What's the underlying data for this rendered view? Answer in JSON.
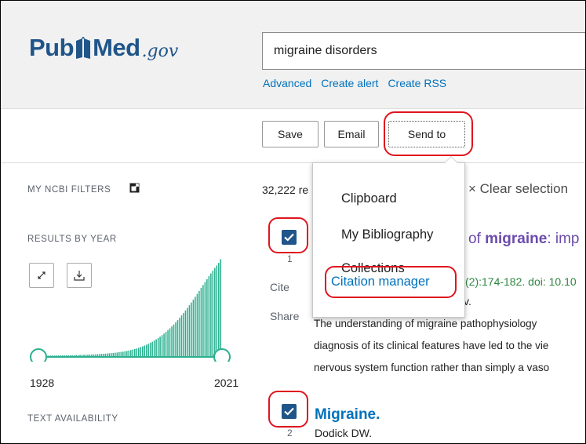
{
  "logo": {
    "pub": "Pub",
    "med": "Med",
    "gov": ".gov"
  },
  "search": {
    "value": "migraine disorders"
  },
  "links": {
    "advanced": "Advanced",
    "create_alert": "Create alert",
    "create_rss": "Create RSS"
  },
  "toolbar": {
    "save": "Save",
    "email": "Email",
    "send_to": "Send to"
  },
  "sidebar": {
    "my_ncbi_filters": "MY NCBI FILTERS",
    "results_by_year": "RESULTS BY YEAR",
    "year_start": "1928",
    "year_end": "2021",
    "text_availability": "TEXT AVAILABILITY"
  },
  "results": {
    "count_text": "32,222 re",
    "clear_selection": "× Clear selection",
    "items": [
      {
        "number": "1",
        "title_prefix": "of ",
        "title_keyword": "migraine",
        "title_suffix": ": imp",
        "citation": "(2):174-182. doi: 10.10",
        "authors": "v.",
        "cite": "Cite",
        "share": "Share",
        "snippet_line1": "The understanding of migraine pathophysiology",
        "snippet_line2": "diagnosis of its clinical features have led to the vie",
        "snippet_line3": "nervous system function rather than simply a vaso"
      },
      {
        "number": "2",
        "title": "Migraine.",
        "authors": "Dodick DW."
      }
    ]
  },
  "send_to_menu": {
    "items": [
      "Clipboard",
      "My Bibliography",
      "Collections",
      "Citation manager"
    ],
    "highlighted": "Citation manager"
  },
  "histogram": {
    "bar_color": "#2bb08f",
    "x_range": [
      1928,
      2021
    ],
    "relative_counts": [
      0.012,
      0.012,
      0.012,
      0.012,
      0.012,
      0.013,
      0.013,
      0.013,
      0.013,
      0.014,
      0.014,
      0.014,
      0.015,
      0.015,
      0.016,
      0.016,
      0.016,
      0.017,
      0.017,
      0.018,
      0.018,
      0.019,
      0.02,
      0.02,
      0.021,
      0.022,
      0.023,
      0.023,
      0.024,
      0.025,
      0.026,
      0.027,
      0.029,
      0.03,
      0.031,
      0.033,
      0.034,
      0.036,
      0.038,
      0.04,
      0.042,
      0.045,
      0.048,
      0.05,
      0.054,
      0.057,
      0.061,
      0.065,
      0.07,
      0.075,
      0.08,
      0.086,
      0.093,
      0.1,
      0.108,
      0.116,
      0.125,
      0.135,
      0.145,
      0.156,
      0.168,
      0.18,
      0.193,
      0.207,
      0.222,
      0.238,
      0.255,
      0.272,
      0.29,
      0.309,
      0.33,
      0.35,
      0.372,
      0.395,
      0.418,
      0.442,
      0.467,
      0.492,
      0.518,
      0.545,
      0.572,
      0.6,
      0.628,
      0.656,
      0.685,
      0.712,
      0.74,
      0.768,
      0.794,
      0.82,
      0.846,
      0.87,
      0.895,
      0.93
    ]
  },
  "colors": {
    "brand_blue": "#20558a",
    "link_blue": "#0071bc",
    "annotation_red": "#e0141e",
    "citation_green": "#2e8540",
    "visited_purple": "#6b4bab"
  }
}
